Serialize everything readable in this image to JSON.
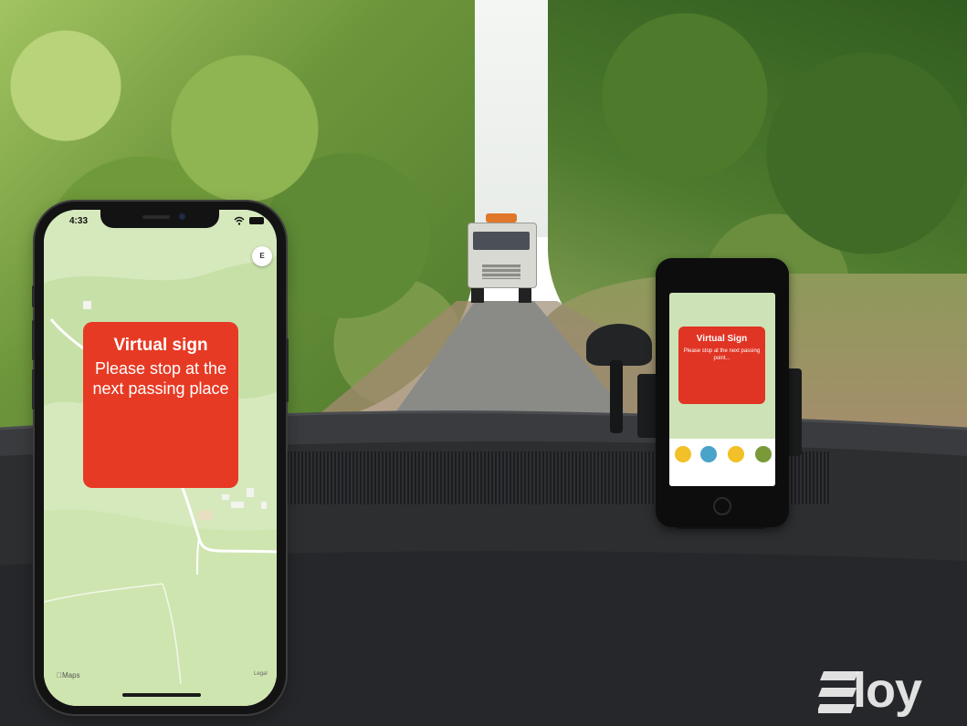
{
  "phone": {
    "time": "4:33",
    "compass_letter": "E",
    "sign_title": "Virtual sign",
    "sign_message": "Please stop at the next passing place",
    "maps_label": "Maps",
    "legal_label": "Legal"
  },
  "car_phone": {
    "sign_title": "Virtual Sign",
    "sign_message": "Please stop at the next passing point..."
  },
  "brand": {
    "logo_text": "loy",
    "logo_full": "Eloy",
    "sign_color": "#e73a24",
    "map_color": "#dcebc5"
  }
}
